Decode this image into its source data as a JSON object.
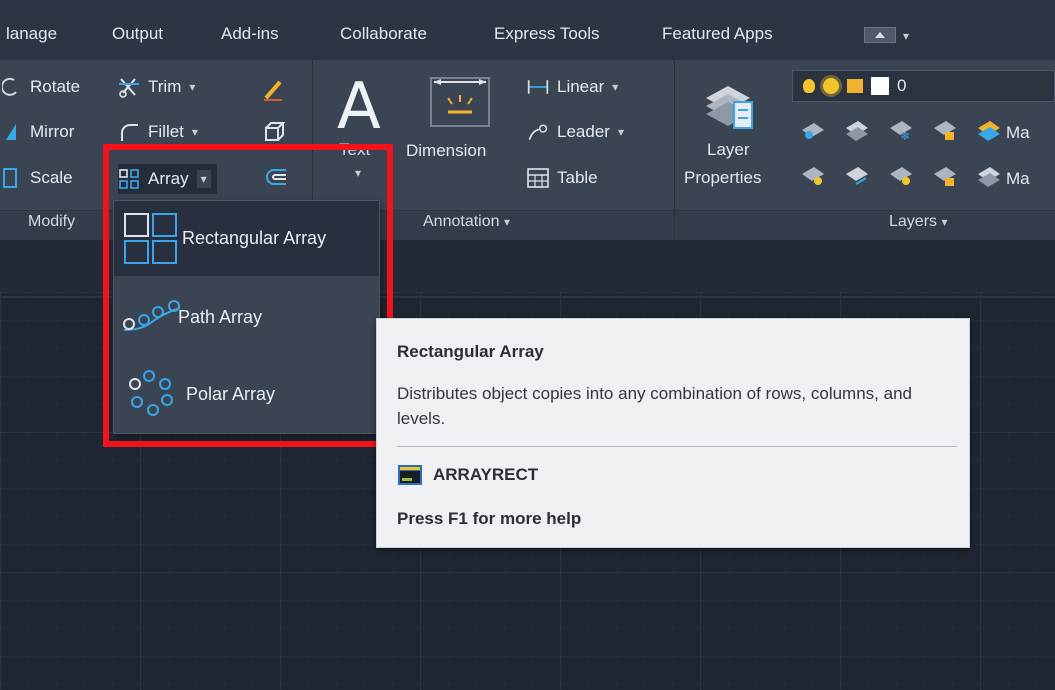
{
  "tabs": [
    "lanage",
    "Output",
    "Add-ins",
    "Collaborate",
    "Express Tools",
    "Featured Apps"
  ],
  "modify": {
    "rotate": "Rotate",
    "mirror": "Mirror",
    "scale": "Scale",
    "trim": "Trim",
    "fillet": "Fillet",
    "array": "Array",
    "title": "Modify"
  },
  "annotation": {
    "text": "Text",
    "dimension": "Dimension",
    "linear": "Linear",
    "leader": "Leader",
    "table": "Table",
    "title": "Annotation"
  },
  "layers": {
    "layer_properties_line1": "Layer",
    "layer_properties_line2": "Properties",
    "current_layer": "0",
    "ma1": "Ma",
    "ma2": "Ma",
    "title": "Layers"
  },
  "array_menu": {
    "items": [
      {
        "label": "Rectangular Array"
      },
      {
        "label": "Path Array"
      },
      {
        "label": "Polar Array"
      }
    ],
    "selected_index": 0
  },
  "tooltip": {
    "title": "Rectangular Array",
    "description": "Distributes object copies into any combination of rows, columns, and levels.",
    "command": "ARRAYRECT",
    "help": "Press F1 for more help"
  },
  "colors": {
    "highlight_box": "#f2131a",
    "ribbon_bg": "#3b4453",
    "tooltip_bg": "#eef0f3"
  }
}
